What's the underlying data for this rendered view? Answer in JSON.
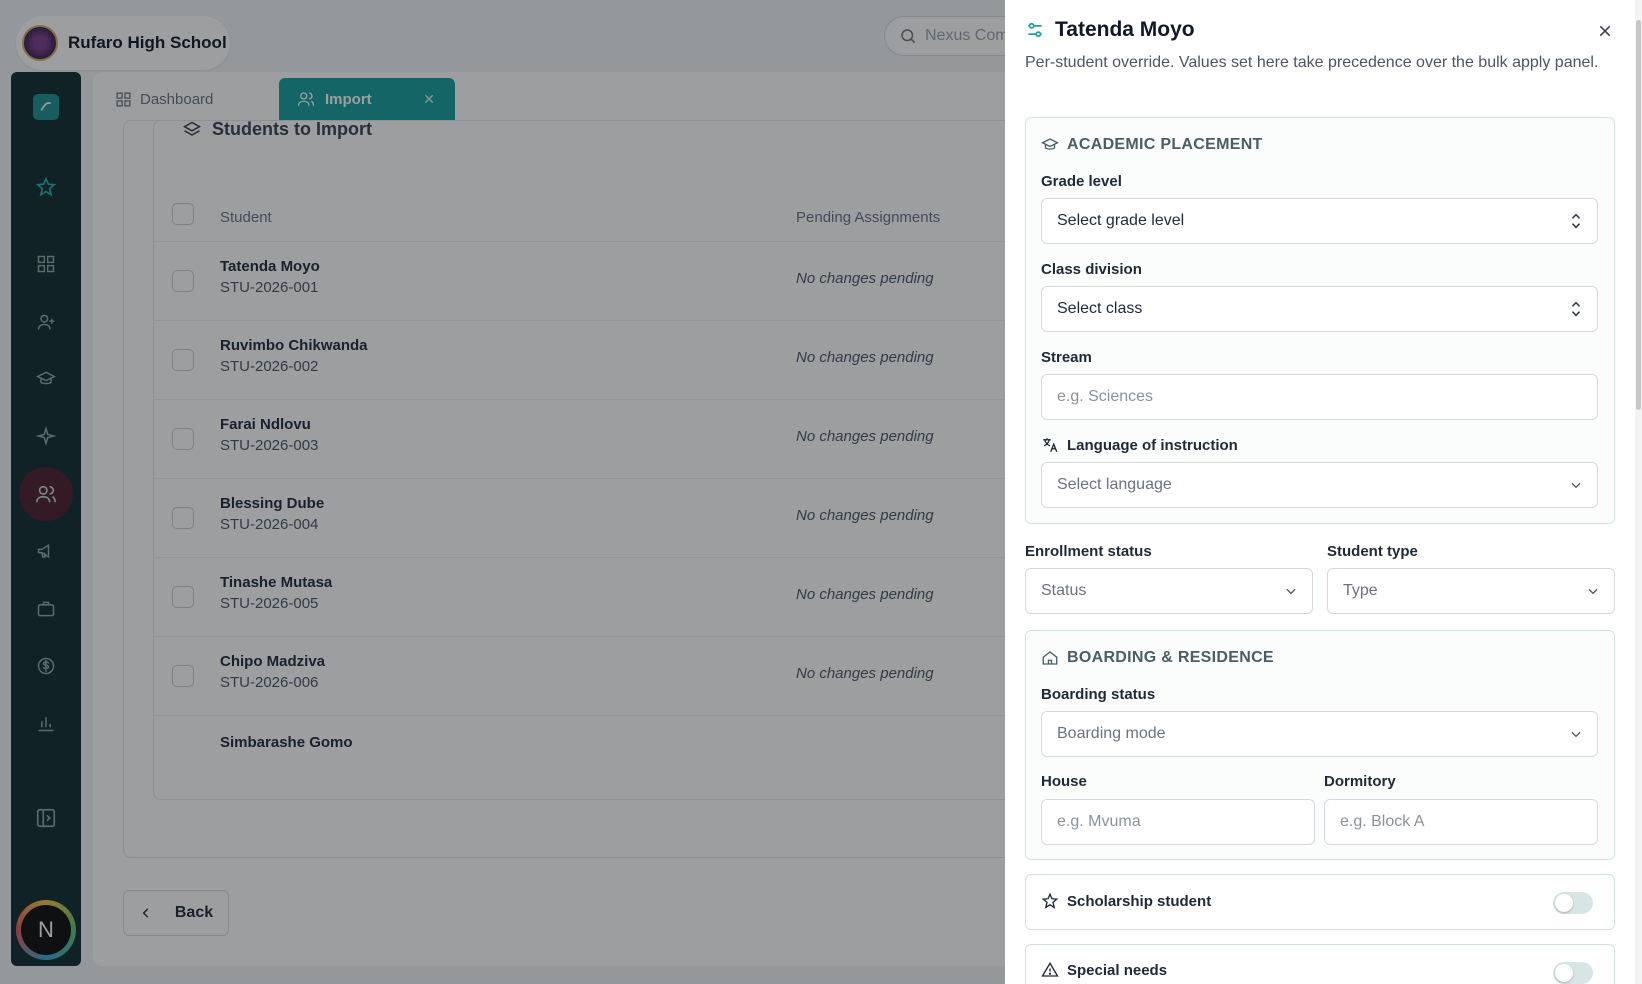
{
  "app": {
    "school_name": "Rufaro High School",
    "search_placeholder": "Nexus Com",
    "user_initial": "N"
  },
  "tabs": [
    {
      "label": "Dashboard"
    },
    {
      "label": "Import"
    }
  ],
  "students_card": {
    "title": "Students to Import",
    "columns": [
      "Student",
      "Pending Assignments"
    ],
    "rows": [
      {
        "name": "Tatenda Moyo",
        "id": "STU-2026-001",
        "pending": "No changes pending"
      },
      {
        "name": "Ruvimbo Chikwanda",
        "id": "STU-2026-002",
        "pending": "No changes pending"
      },
      {
        "name": "Farai Ndlovu",
        "id": "STU-2026-003",
        "pending": "No changes pending"
      },
      {
        "name": "Blessing Dube",
        "id": "STU-2026-004",
        "pending": "No changes pending"
      },
      {
        "name": "Tinashe Mutasa",
        "id": "STU-2026-005",
        "pending": "No changes pending"
      },
      {
        "name": "Chipo Madziva",
        "id": "STU-2026-006",
        "pending": "No changes pending"
      },
      {
        "name": "Simbarashe Gomo",
        "id": "",
        "pending": ""
      }
    ],
    "back_label": "Back"
  },
  "drawer": {
    "title": "Tatenda Moyo",
    "subtitle": "Per-student override. Values set here take precedence over the bulk apply panel.",
    "academic": {
      "heading": "ACADEMIC PLACEMENT",
      "grade_label": "Grade level",
      "grade_value": "Select grade level",
      "class_label": "Class division",
      "class_value": "Select class",
      "stream_label": "Stream",
      "stream_placeholder": "e.g. Sciences",
      "language_label": "Language of instruction",
      "language_value": "Select language"
    },
    "enrollment_label": "Enrollment status",
    "enrollment_value": "Status",
    "type_label": "Student type",
    "type_value": "Type",
    "boarding": {
      "heading": "BOARDING & RESIDENCE",
      "status_label": "Boarding status",
      "status_value": "Boarding mode",
      "house_label": "House",
      "house_placeholder": "e.g. Mvuma",
      "dorm_label": "Dormitory",
      "dorm_placeholder": "e.g. Block A"
    },
    "scholarship_label": "Scholarship student",
    "special_needs_label": "Special needs"
  },
  "colors": {
    "accent": "#159e9a",
    "rail": "#0f2a2e",
    "section_border": "#cfe3e0"
  }
}
